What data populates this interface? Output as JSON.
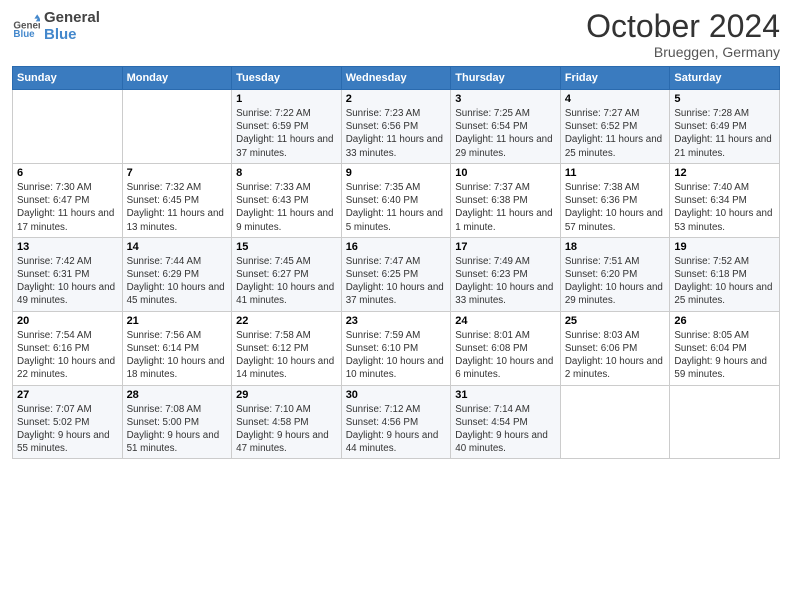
{
  "header": {
    "logo_general": "General",
    "logo_blue": "Blue",
    "month": "October 2024",
    "location": "Brueggen, Germany"
  },
  "weekdays": [
    "Sunday",
    "Monday",
    "Tuesday",
    "Wednesday",
    "Thursday",
    "Friday",
    "Saturday"
  ],
  "weeks": [
    [
      null,
      null,
      {
        "day": "1",
        "sunrise": "7:22 AM",
        "sunset": "6:59 PM",
        "daylight": "11 hours and 37 minutes."
      },
      {
        "day": "2",
        "sunrise": "7:23 AM",
        "sunset": "6:56 PM",
        "daylight": "11 hours and 33 minutes."
      },
      {
        "day": "3",
        "sunrise": "7:25 AM",
        "sunset": "6:54 PM",
        "daylight": "11 hours and 29 minutes."
      },
      {
        "day": "4",
        "sunrise": "7:27 AM",
        "sunset": "6:52 PM",
        "daylight": "11 hours and 25 minutes."
      },
      {
        "day": "5",
        "sunrise": "7:28 AM",
        "sunset": "6:49 PM",
        "daylight": "11 hours and 21 minutes."
      }
    ],
    [
      {
        "day": "6",
        "sunrise": "7:30 AM",
        "sunset": "6:47 PM",
        "daylight": "11 hours and 17 minutes."
      },
      {
        "day": "7",
        "sunrise": "7:32 AM",
        "sunset": "6:45 PM",
        "daylight": "11 hours and 13 minutes."
      },
      {
        "day": "8",
        "sunrise": "7:33 AM",
        "sunset": "6:43 PM",
        "daylight": "11 hours and 9 minutes."
      },
      {
        "day": "9",
        "sunrise": "7:35 AM",
        "sunset": "6:40 PM",
        "daylight": "11 hours and 5 minutes."
      },
      {
        "day": "10",
        "sunrise": "7:37 AM",
        "sunset": "6:38 PM",
        "daylight": "11 hours and 1 minute."
      },
      {
        "day": "11",
        "sunrise": "7:38 AM",
        "sunset": "6:36 PM",
        "daylight": "10 hours and 57 minutes."
      },
      {
        "day": "12",
        "sunrise": "7:40 AM",
        "sunset": "6:34 PM",
        "daylight": "10 hours and 53 minutes."
      }
    ],
    [
      {
        "day": "13",
        "sunrise": "7:42 AM",
        "sunset": "6:31 PM",
        "daylight": "10 hours and 49 minutes."
      },
      {
        "day": "14",
        "sunrise": "7:44 AM",
        "sunset": "6:29 PM",
        "daylight": "10 hours and 45 minutes."
      },
      {
        "day": "15",
        "sunrise": "7:45 AM",
        "sunset": "6:27 PM",
        "daylight": "10 hours and 41 minutes."
      },
      {
        "day": "16",
        "sunrise": "7:47 AM",
        "sunset": "6:25 PM",
        "daylight": "10 hours and 37 minutes."
      },
      {
        "day": "17",
        "sunrise": "7:49 AM",
        "sunset": "6:23 PM",
        "daylight": "10 hours and 33 minutes."
      },
      {
        "day": "18",
        "sunrise": "7:51 AM",
        "sunset": "6:20 PM",
        "daylight": "10 hours and 29 minutes."
      },
      {
        "day": "19",
        "sunrise": "7:52 AM",
        "sunset": "6:18 PM",
        "daylight": "10 hours and 25 minutes."
      }
    ],
    [
      {
        "day": "20",
        "sunrise": "7:54 AM",
        "sunset": "6:16 PM",
        "daylight": "10 hours and 22 minutes."
      },
      {
        "day": "21",
        "sunrise": "7:56 AM",
        "sunset": "6:14 PM",
        "daylight": "10 hours and 18 minutes."
      },
      {
        "day": "22",
        "sunrise": "7:58 AM",
        "sunset": "6:12 PM",
        "daylight": "10 hours and 14 minutes."
      },
      {
        "day": "23",
        "sunrise": "7:59 AM",
        "sunset": "6:10 PM",
        "daylight": "10 hours and 10 minutes."
      },
      {
        "day": "24",
        "sunrise": "8:01 AM",
        "sunset": "6:08 PM",
        "daylight": "10 hours and 6 minutes."
      },
      {
        "day": "25",
        "sunrise": "8:03 AM",
        "sunset": "6:06 PM",
        "daylight": "10 hours and 2 minutes."
      },
      {
        "day": "26",
        "sunrise": "8:05 AM",
        "sunset": "6:04 PM",
        "daylight": "9 hours and 59 minutes."
      }
    ],
    [
      {
        "day": "27",
        "sunrise": "7:07 AM",
        "sunset": "5:02 PM",
        "daylight": "9 hours and 55 minutes."
      },
      {
        "day": "28",
        "sunrise": "7:08 AM",
        "sunset": "5:00 PM",
        "daylight": "9 hours and 51 minutes."
      },
      {
        "day": "29",
        "sunrise": "7:10 AM",
        "sunset": "4:58 PM",
        "daylight": "9 hours and 47 minutes."
      },
      {
        "day": "30",
        "sunrise": "7:12 AM",
        "sunset": "4:56 PM",
        "daylight": "9 hours and 44 minutes."
      },
      {
        "day": "31",
        "sunrise": "7:14 AM",
        "sunset": "4:54 PM",
        "daylight": "9 hours and 40 minutes."
      },
      null,
      null
    ]
  ],
  "labels": {
    "sunrise": "Sunrise:",
    "sunset": "Sunset:",
    "daylight": "Daylight:"
  }
}
